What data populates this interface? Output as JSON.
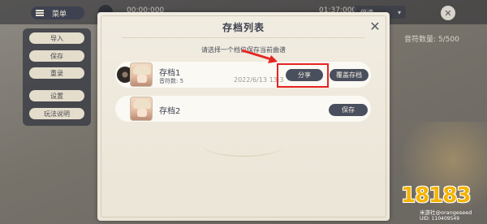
{
  "background": {
    "menu_label": "菜单",
    "time_elapsed": "00:00:000",
    "time_total": "01:37:000",
    "speed_label": "倍速",
    "note_count": "音符数量: 5/500",
    "side_menu": [
      "导入",
      "保存",
      "重录",
      "设置",
      "玩法说明"
    ]
  },
  "dialog": {
    "title": "存档列表",
    "hint": "请选择一个档位保存当前曲谱",
    "slots": [
      {
        "name": "存档1",
        "notes": "音符数: 5",
        "date": "2022/6/13 13:3",
        "share_label": "分享",
        "overwrite_label": "覆盖存档"
      },
      {
        "name": "存档2",
        "save_label": "保存"
      }
    ]
  },
  "annotation": {
    "color": "#e52520"
  },
  "watermark": {
    "logo": "18183",
    "site": "米游社@orangeseed",
    "uid": "UID: 110409549"
  }
}
